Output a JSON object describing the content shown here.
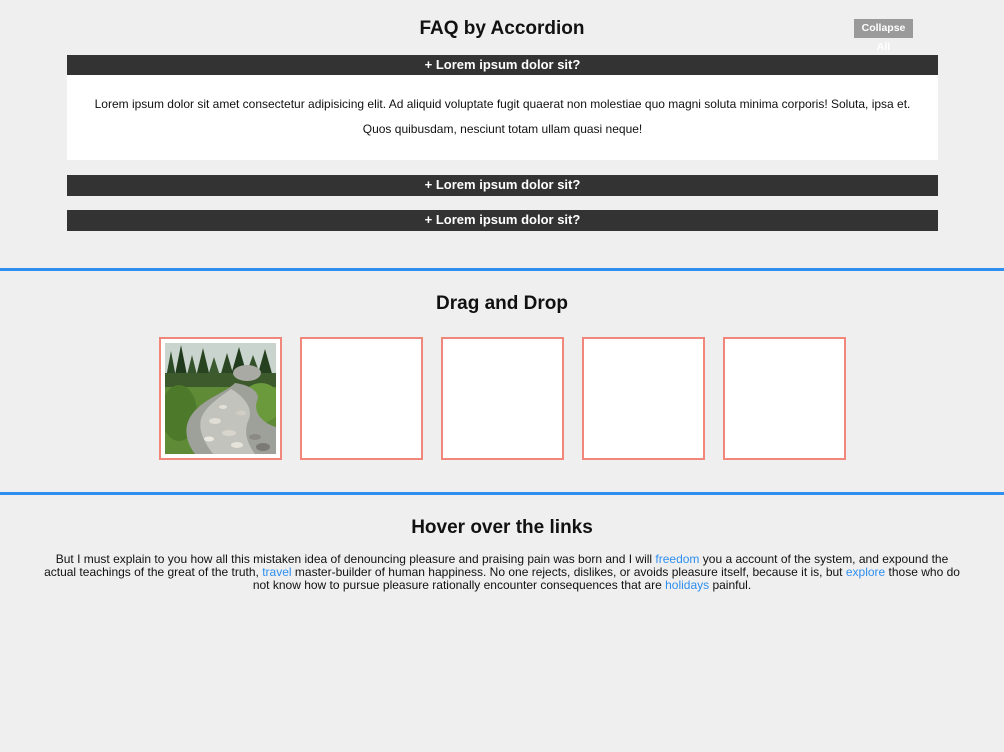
{
  "faq": {
    "title": "FAQ by Accordion",
    "collapse_label": "Collapse All",
    "items": [
      {
        "header": "+ Lorem ipsum dolor sit?",
        "content_line1": "Lorem ipsum dolor sit amet consectetur adipisicing elit. Ad aliquid voluptate fugit quaerat non molestiae quo magni soluta minima corporis! Soluta, ipsa et.",
        "content_line2": "Quos quibusdam, nesciunt totam ullam quasi neque!"
      },
      {
        "header": "+ Lorem ipsum dolor sit?"
      },
      {
        "header": "+ Lorem ipsum dolor sit?"
      }
    ]
  },
  "drag_drop": {
    "title": "Drag and Drop",
    "box_count": 5,
    "image_subject": "mountain stream with rocks and pine trees"
  },
  "hover": {
    "title": "Hover over the links",
    "text1": "But I must explain to you how all this mistaken idea of denouncing pleasure and praising pain was born and I will ",
    "link1": "freedom",
    "text2": " you a account of the system, and expound the actual teachings of the great of the truth, ",
    "link2": "travel",
    "text3": " master-builder of human happiness. No one rejects, dislikes, or avoids pleasure itself, because it is, but ",
    "link3": "explore",
    "text4": " those who do not know how to pursue pleasure rationally encounter consequences that are ",
    "link4": "holidays",
    "text5": " painful."
  },
  "colors": {
    "background": "#efefef",
    "accordion_header": "#333333",
    "divider": "#2e8ff0",
    "drop_border": "#f0877a",
    "link": "#2e8ff0",
    "collapse_button": "#9a9a9a"
  }
}
